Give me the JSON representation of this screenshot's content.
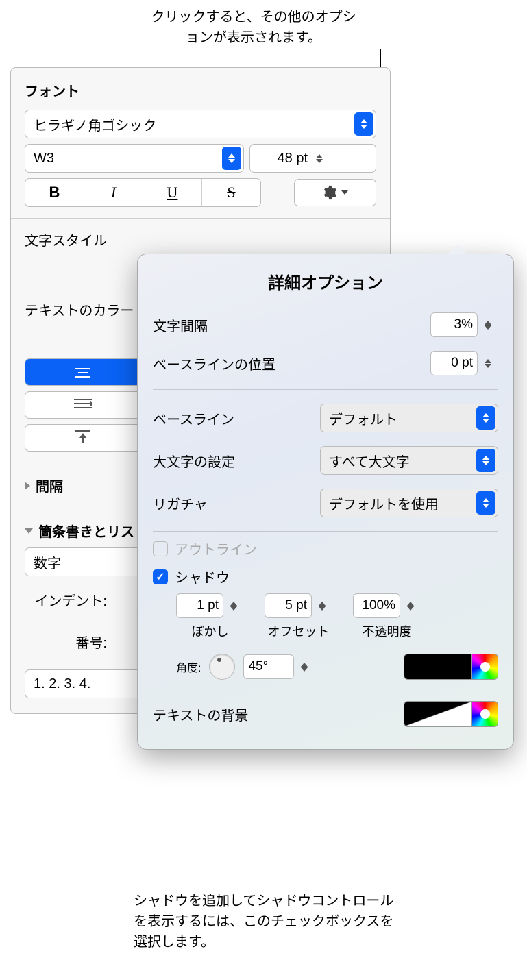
{
  "callouts": {
    "top": "クリックすると、その他のオプションが表示されます。",
    "bottom": "シャドウを追加してシャドウコントロールを表示するには、このチェックボックスを選択します。"
  },
  "inspector": {
    "font_section": "フォント",
    "font_family": "ヒラギノ角ゴシック",
    "font_weight": "W3",
    "font_size": "48 pt",
    "style_buttons": {
      "bold": "B",
      "italic": "I",
      "underline": "U",
      "strike": "S"
    },
    "char_style": "文字スタイル",
    "text_color": "テキストのカラー",
    "spacing": "間隔",
    "bullets_lists": "箇条書きとリスト",
    "list_style": "数字",
    "indent_label": "インデント:",
    "number_label": "番号:",
    "list_format": "1. 2. 3. 4."
  },
  "popover": {
    "title": "詳細オプション",
    "char_spacing": {
      "label": "文字間隔",
      "value": "3%"
    },
    "baseline_shift": {
      "label": "ベースラインの位置",
      "value": "0 pt"
    },
    "baseline": {
      "label": "ベースライン",
      "value": "デフォルト"
    },
    "capitalization": {
      "label": "大文字の設定",
      "value": "すべて大文字"
    },
    "ligatures": {
      "label": "リガチャ",
      "value": "デフォルトを使用"
    },
    "outline": "アウトライン",
    "shadow": "シャドウ",
    "blur": {
      "label": "ぼかし",
      "value": "1 pt"
    },
    "offset": {
      "label": "オフセット",
      "value": "5 pt"
    },
    "opacity": {
      "label": "不透明度",
      "value": "100%"
    },
    "angle": {
      "label": "角度:",
      "value": "45°"
    },
    "text_background": "テキストの背景"
  }
}
